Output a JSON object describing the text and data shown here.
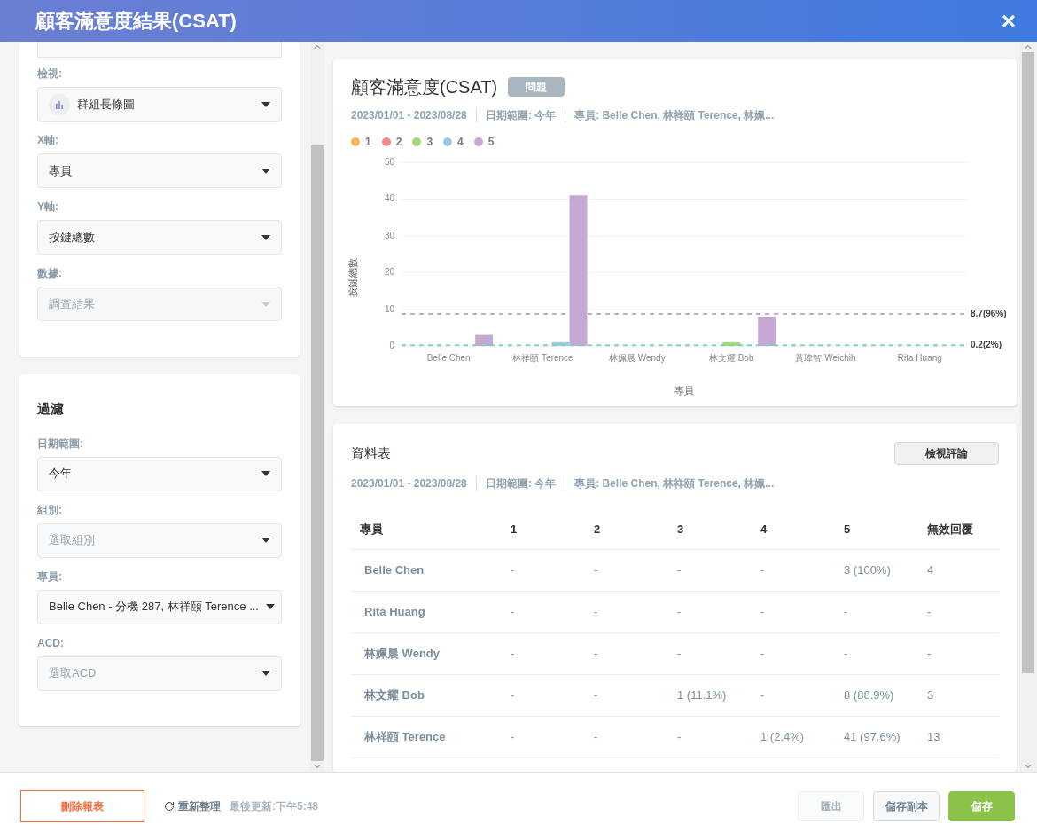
{
  "window": {
    "title": "顧客滿意度結果(CSAT)",
    "close": "×"
  },
  "settings": {
    "fields": [
      {
        "label": "檢視:",
        "value": "群組長條圖",
        "kind": "chart",
        "disabled": false
      },
      {
        "label": "X軸:",
        "value": "專員",
        "kind": "plain",
        "disabled": false
      },
      {
        "label": "Y軸:",
        "value": "按鍵總數",
        "kind": "plain",
        "disabled": false
      },
      {
        "label": "數據:",
        "value": "調查結果",
        "kind": "plain",
        "disabled": true
      }
    ]
  },
  "filters": {
    "title": "過濾",
    "fields": [
      {
        "label": "日期範圍:",
        "value": "今年"
      },
      {
        "label": "組別:",
        "placeholder": "選取組別"
      },
      {
        "label": "專員:",
        "value": "Belle Chen - 分機 287, 林祥頤 Terence ..."
      },
      {
        "label": "ACD:",
        "placeholder": "選取ACD"
      }
    ]
  },
  "chart_card": {
    "title": "顧客滿意度(CSAT)",
    "tag": "問題",
    "meta": [
      "2023/01/01 - 2023/08/28",
      "日期範圍: 今年",
      "專員: Belle Chen, 林祥頤 Terence, 林姵..."
    ],
    "chart_data": {
      "type": "bar",
      "xlabel": "專員",
      "ylabel": "按鍵總數",
      "categories": [
        "Belle Chen",
        "林祥頤 Terence",
        "林姵晨 Wendy",
        "林文耀 Bob",
        "黃瑋智 Weichih",
        "Rita Huang"
      ],
      "ylim": [
        0,
        50
      ],
      "yticks": [
        0,
        10,
        20,
        30,
        40,
        50
      ],
      "series": [
        {
          "name": "1",
          "color": "#f9b65b",
          "values": [
            0,
            0,
            0,
            0,
            0,
            0
          ]
        },
        {
          "name": "2",
          "color": "#f28b8b",
          "values": [
            0,
            0,
            0,
            0,
            0,
            0
          ]
        },
        {
          "name": "3",
          "color": "#a5d87b",
          "values": [
            0,
            0,
            0,
            1,
            0,
            0
          ]
        },
        {
          "name": "4",
          "color": "#9ecae1",
          "values": [
            0,
            1,
            0,
            0,
            0,
            0
          ]
        },
        {
          "name": "5",
          "color": "#c5a9d4",
          "values": [
            3,
            41,
            0,
            8,
            0,
            0
          ]
        }
      ],
      "grid": true,
      "legend": true,
      "ref_lines": [
        {
          "axis": "y",
          "value": 8.7,
          "label": "8.7(96%)",
          "color": "#c5a9d4"
        },
        {
          "axis": "y",
          "value": 0.2,
          "label": "0.2(2%)",
          "color": "#7ecfc7"
        }
      ]
    }
  },
  "table_card": {
    "title": "資料表",
    "button": "檢視評論",
    "meta": [
      "2023/01/01 - 2023/08/28",
      "日期範圍: 今年",
      "專員: Belle Chen, 林祥頤 Terence, 林姵..."
    ],
    "columns": [
      "專員",
      "1",
      "2",
      "3",
      "4",
      "5",
      "無效回覆"
    ],
    "rows": [
      [
        "Belle Chen",
        "-",
        "-",
        "-",
        "-",
        "3 (100%)",
        "4"
      ],
      [
        "Rita Huang",
        "-",
        "-",
        "-",
        "-",
        "-",
        "-"
      ],
      [
        "林姵晨 Wendy",
        "-",
        "-",
        "-",
        "-",
        "-",
        "-"
      ],
      [
        "林文耀 Bob",
        "-",
        "-",
        "1 (11.1%)",
        "-",
        "8 (88.9%)",
        "3"
      ],
      [
        "林祥頤 Terence",
        "-",
        "-",
        "-",
        "1 (2.4%)",
        "41 (97.6%)",
        "13"
      ]
    ]
  },
  "footer": {
    "delete": "刪除報表",
    "refresh": "重新整理",
    "updated": "最後更新:下午5:48",
    "buttons": [
      {
        "label": "匯出",
        "kind": "plain",
        "disabled": true
      },
      {
        "label": "儲存副本",
        "kind": "plain",
        "disabled": false
      },
      {
        "label": "儲存",
        "kind": "primary",
        "disabled": false
      }
    ]
  }
}
